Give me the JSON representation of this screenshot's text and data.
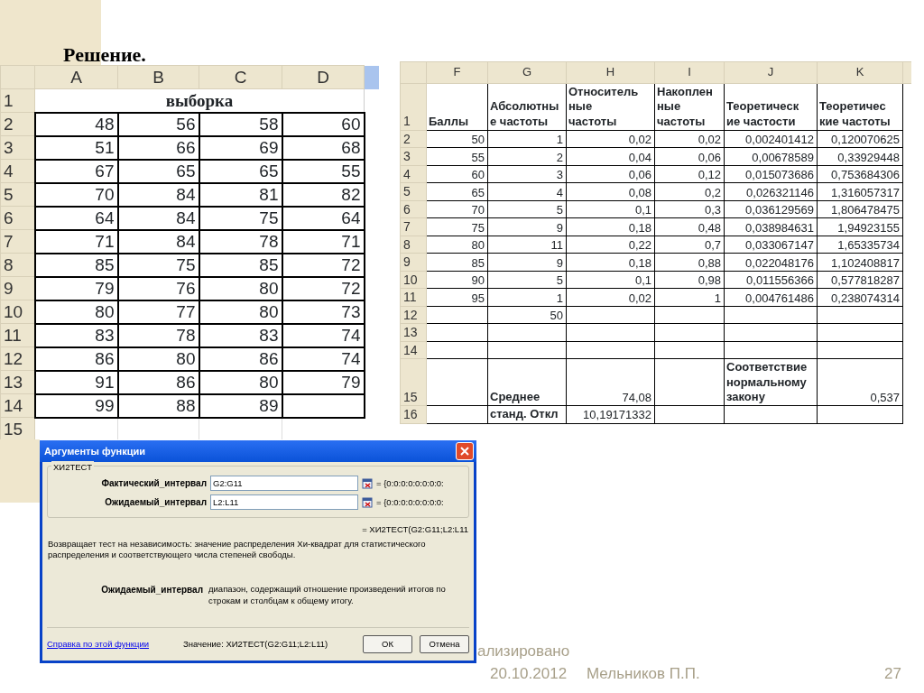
{
  "slide": {
    "title": "Решение."
  },
  "left_sheet": {
    "columns": [
      "A",
      "B",
      "C",
      "D"
    ],
    "title_row": {
      "number": "1",
      "text": "выборка"
    },
    "rows": [
      {
        "number": "2",
        "cells": [
          "48",
          "56",
          "58",
          "60"
        ]
      },
      {
        "number": "3",
        "cells": [
          "51",
          "66",
          "69",
          "68"
        ]
      },
      {
        "number": "4",
        "cells": [
          "67",
          "65",
          "65",
          "55"
        ]
      },
      {
        "number": "5",
        "cells": [
          "70",
          "84",
          "81",
          "82"
        ]
      },
      {
        "number": "6",
        "cells": [
          "64",
          "84",
          "75",
          "64"
        ]
      },
      {
        "number": "7",
        "cells": [
          "71",
          "84",
          "78",
          "71"
        ]
      },
      {
        "number": "8",
        "cells": [
          "85",
          "75",
          "85",
          "72"
        ]
      },
      {
        "number": "9",
        "cells": [
          "79",
          "76",
          "80",
          "72"
        ]
      },
      {
        "number": "10",
        "cells": [
          "80",
          "77",
          "80",
          "73"
        ]
      },
      {
        "number": "11",
        "cells": [
          "83",
          "78",
          "83",
          "74"
        ]
      },
      {
        "number": "12",
        "cells": [
          "86",
          "80",
          "86",
          "74"
        ]
      },
      {
        "number": "13",
        "cells": [
          "91",
          "86",
          "80",
          "79"
        ]
      },
      {
        "number": "14",
        "cells": [
          "99",
          "88",
          "89"
        ]
      },
      {
        "number": "15",
        "cells": []
      }
    ]
  },
  "right_sheet": {
    "columns": [
      "F",
      "G",
      "H",
      "I",
      "J",
      "K"
    ],
    "rows": [
      {
        "number": "1",
        "cells": {
          "F": {
            "lines": [
              "Баллы"
            ]
          },
          "G": {
            "lines": [
              "Абсолютны",
              "е частоты"
            ]
          },
          "H": {
            "lines": [
              "Относитель",
              "ные",
              "частоты"
            ]
          },
          "I": {
            "lines": [
              "Накоплен",
              "ные",
              "частоты"
            ]
          },
          "J": {
            "lines": [
              "Теоретическ",
              "ие частости"
            ]
          },
          "K": {
            "lines": [
              "Теоретичес",
              "кие частоты"
            ]
          }
        }
      },
      {
        "number": "2",
        "cells": {
          "F": "50",
          "G": "1",
          "H": "0,02",
          "I": "0,02",
          "J": "0,002401412",
          "K": "0,120070625"
        }
      },
      {
        "number": "3",
        "cells": {
          "F": "55",
          "G": "2",
          "H": "0,04",
          "I": "0,06",
          "J": "0,00678589",
          "K": "0,33929448"
        }
      },
      {
        "number": "4",
        "cells": {
          "F": "60",
          "G": "3",
          "H": "0,06",
          "I": "0,12",
          "J": "0,015073686",
          "K": "0,753684306"
        }
      },
      {
        "number": "5",
        "cells": {
          "F": "65",
          "G": "4",
          "H": "0,08",
          "I": "0,2",
          "J": "0,026321146",
          "K": "1,316057317"
        }
      },
      {
        "number": "6",
        "cells": {
          "F": "70",
          "G": "5",
          "H": "0,1",
          "I": "0,3",
          "J": "0,036129569",
          "K": "1,806478475"
        }
      },
      {
        "number": "7",
        "cells": {
          "F": "75",
          "G": "9",
          "H": "0,18",
          "I": "0,48",
          "J": "0,038984631",
          "K": "1,94923155"
        }
      },
      {
        "number": "8",
        "cells": {
          "F": "80",
          "G": "11",
          "H": "0,22",
          "I": "0,7",
          "J": "0,033067147",
          "K": "1,65335734"
        }
      },
      {
        "number": "9",
        "cells": {
          "F": "85",
          "G": "9",
          "H": "0,18",
          "I": "0,88",
          "J": "0,022048176",
          "K": "1,102408817"
        }
      },
      {
        "number": "10",
        "cells": {
          "F": "90",
          "G": "5",
          "H": "0,1",
          "I": "0,98",
          "J": "0,011556366",
          "K": "0,577818287"
        }
      },
      {
        "number": "11",
        "cells": {
          "F": "95",
          "G": "1",
          "H": "0,02",
          "I": "1",
          "J": "0,004761486",
          "K": "0,238074314"
        }
      },
      {
        "number": "12",
        "cells": {
          "G": "50"
        }
      },
      {
        "number": "13",
        "cells": {}
      },
      {
        "number": "14",
        "cells": {}
      },
      {
        "number": "15",
        "cells": {
          "G": {
            "lines": [
              "Среднее"
            ]
          },
          "H": "74,08",
          "J": {
            "lines": [
              "Соответствие",
              "нормальному",
              "закону"
            ]
          },
          "K": "0,537"
        }
      },
      {
        "number": "16",
        "cells": {
          "G": {
            "lines": [
              "станд. Откл"
            ]
          },
          "H": "10,19171332"
        }
      }
    ]
  },
  "dialog": {
    "title": "Аргументы функции",
    "function_name": "ХИ2ТЕСТ",
    "arguments": [
      {
        "label": "Фактический_интервал",
        "value": "G2:G11",
        "result": "= {0:0:0:0:0:0:0:0:"
      },
      {
        "label": "Ожидаемый_интервал",
        "value": "L2:L11",
        "result": "= {0:0:0:0:0:0:0:0:"
      }
    ],
    "formula_result": "= ХИ2ТЕСТ(G2:G11;L2:L11",
    "description": "Возвращает тест на независимость: значение распределения Хи-квадрат для статистического распределения и соответствующего числа степеней свободы.",
    "argument_help": {
      "label": "Ожидаемый_интервал",
      "text": "диапазон, содержащий отношение произведений итогов по строкам и столбцам к общему итогу."
    },
    "help_link": "Справка по этой функции",
    "value_text": "Значение: ХИ2ТЕСТ(G2:G11;L2:L11)",
    "buttons": [
      "ОК",
      "Отмена"
    ]
  },
  "footer": {
    "partial_text": "ализировано",
    "date": "20.10.2012",
    "author": "Мельников П.П.",
    "page": "27"
  }
}
